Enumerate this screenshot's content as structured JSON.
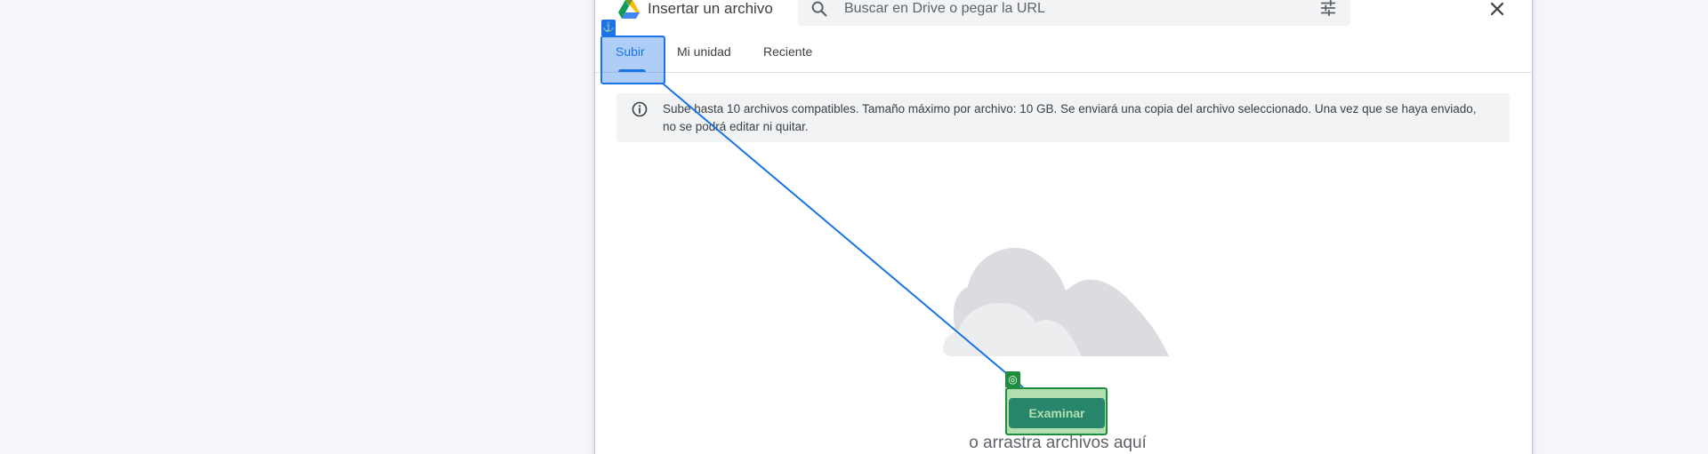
{
  "dialog": {
    "title": "Insertar un archivo",
    "close_icon": "close-icon"
  },
  "search": {
    "placeholder": "Buscar en Drive o pegar la URL",
    "value": "",
    "icon": "search-icon",
    "filter_icon": "tune-icon"
  },
  "tabs": [
    {
      "label": "Subir",
      "active": true
    },
    {
      "label": "Mi unidad",
      "active": false
    },
    {
      "label": "Reciente",
      "active": false
    }
  ],
  "info": {
    "icon": "info-icon",
    "text": "Sube hasta 10 archivos compatibles. Tamaño máximo por archivo: 10 GB. Se enviará una copia del archivo seleccionado. Una vez que se haya enviado, no se podrá editar ni quitar."
  },
  "upload": {
    "illustration": "cloud-illustration",
    "browse_label": "Examinar",
    "drag_hint": "o arrastra archivos aquí"
  },
  "annotation": {
    "source_icon": "anchor-icon",
    "target_icon": "target-icon",
    "source_color": "#1a73e8",
    "target_color": "#1e8e3e"
  },
  "colors": {
    "accent": "#1a73e8",
    "button": "#1a6a8c",
    "banner": "#f1f3f4"
  }
}
